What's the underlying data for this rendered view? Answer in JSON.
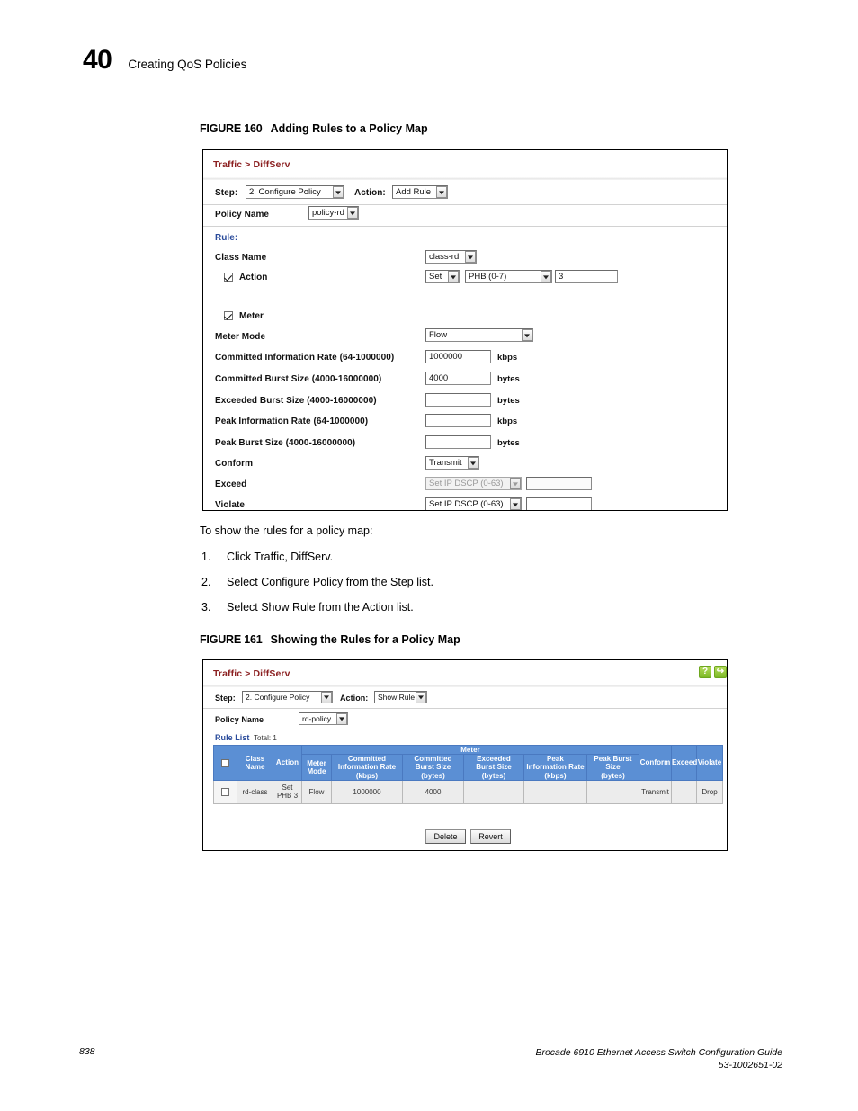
{
  "page": {
    "chapter_number": "40",
    "chapter_title": "Creating QoS Policies",
    "footer_page_number": "838",
    "footer_guide": "Brocade 6910 Ethernet Access Switch Configuration Guide",
    "footer_docnum": "53-1002651-02"
  },
  "figure160": {
    "label": "FIGURE 160",
    "title": "Adding Rules to a Policy Map",
    "breadcrumb": "Traffic > DiffServ",
    "step_label": "Step:",
    "step_value": "2. Configure Policy",
    "action_label": "Action:",
    "action_value": "Add Rule",
    "policy_name_label": "Policy Name",
    "policy_name_value": "policy-rd",
    "rule_label": "Rule:",
    "class_name_label": "Class Name",
    "class_name_value": "class-rd",
    "action_row_label": "Action",
    "action_set_value": "Set",
    "action_phb_value": "PHB (0-7)",
    "action_phb_input": "3",
    "meter_label": "Meter",
    "meter_mode_label": "Meter Mode",
    "meter_mode_value": "Flow",
    "cir_label": "Committed Information Rate (64-1000000)",
    "cir_value": "1000000",
    "cir_unit": "kbps",
    "cbs_label": "Committed Burst Size (4000-16000000)",
    "cbs_value": "4000",
    "cbs_unit": "bytes",
    "ebs_label": "Exceeded Burst Size (4000-16000000)",
    "ebs_value": "",
    "ebs_unit": "bytes",
    "pir_label": "Peak Information Rate (64-1000000)",
    "pir_value": "",
    "pir_unit": "kbps",
    "pbs_label": "Peak Burst Size (4000-16000000)",
    "pbs_value": "",
    "pbs_unit": "bytes",
    "conform_label": "Conform",
    "conform_value": "Transmit",
    "exceed_label": "Exceed",
    "exceed_value": "Set IP DSCP (0-63)",
    "exceed_input": "",
    "violate_label": "Violate",
    "violate_value": "Set IP DSCP (0-63)",
    "violate_input": ""
  },
  "instructions": {
    "intro": "To show the rules for a policy map:",
    "steps": [
      {
        "num": "1.",
        "text": "Click Traffic, DiffServ."
      },
      {
        "num": "2.",
        "text": "Select Configure Policy from the Step list."
      },
      {
        "num": "3.",
        "text": "Select Show Rule from the Action list."
      }
    ]
  },
  "figure161": {
    "label": "FIGURE 161",
    "title": "Showing the Rules for a Policy Map",
    "breadcrumb": "Traffic > DiffServ",
    "step_label": "Step:",
    "step_value": "2. Configure Policy",
    "action_label": "Action:",
    "action_value": "Show Rule",
    "policy_name_label": "Policy Name",
    "policy_name_value": "rd-policy",
    "rule_list_label": "Rule List",
    "rule_list_total": "Total: 1",
    "help_icon_label": "?",
    "logout_icon_label": "↪",
    "table": {
      "group_header": "Meter",
      "columns": [
        "",
        "Class Name",
        "Action",
        "Meter Mode",
        "Committed Information Rate (kbps)",
        "Committed Burst Size (bytes)",
        "Exceeded Burst Size (bytes)",
        "Peak Information Rate (kbps)",
        "Peak Burst Size (bytes)",
        "Conform",
        "Exceed",
        "Violate"
      ],
      "columns_lines": [
        [
          ""
        ],
        [
          "Class",
          "Name"
        ],
        [
          "Action"
        ],
        [
          "Meter",
          "Mode"
        ],
        [
          "Committed",
          "Information Rate",
          "(kbps)"
        ],
        [
          "Committed",
          "Burst Size",
          "(bytes)"
        ],
        [
          "Exceeded",
          "Burst Size",
          "(bytes)"
        ],
        [
          "Peak",
          "Information Rate",
          "(kbps)"
        ],
        [
          "Peak Burst",
          "Size",
          "(bytes)"
        ],
        [
          "Conform"
        ],
        [
          "Exceed"
        ],
        [
          "Violate"
        ]
      ],
      "rows": [
        {
          "checked": false,
          "class_name": "rd-class",
          "action_lines": [
            "Set",
            "PHB 3"
          ],
          "meter_mode": "Flow",
          "cir": "1000000",
          "cbs": "4000",
          "ebs": "",
          "pir": "",
          "pbs": "",
          "conform": "Transmit",
          "exceed": "",
          "violate": "Drop"
        }
      ]
    },
    "delete_button": "Delete",
    "revert_button": "Revert"
  },
  "colors": {
    "breadcrumb": "#8c2122",
    "link_blue": "#2a4b9b",
    "table_header_bg": "#5b8fd4",
    "help_green": "#7cb827"
  }
}
